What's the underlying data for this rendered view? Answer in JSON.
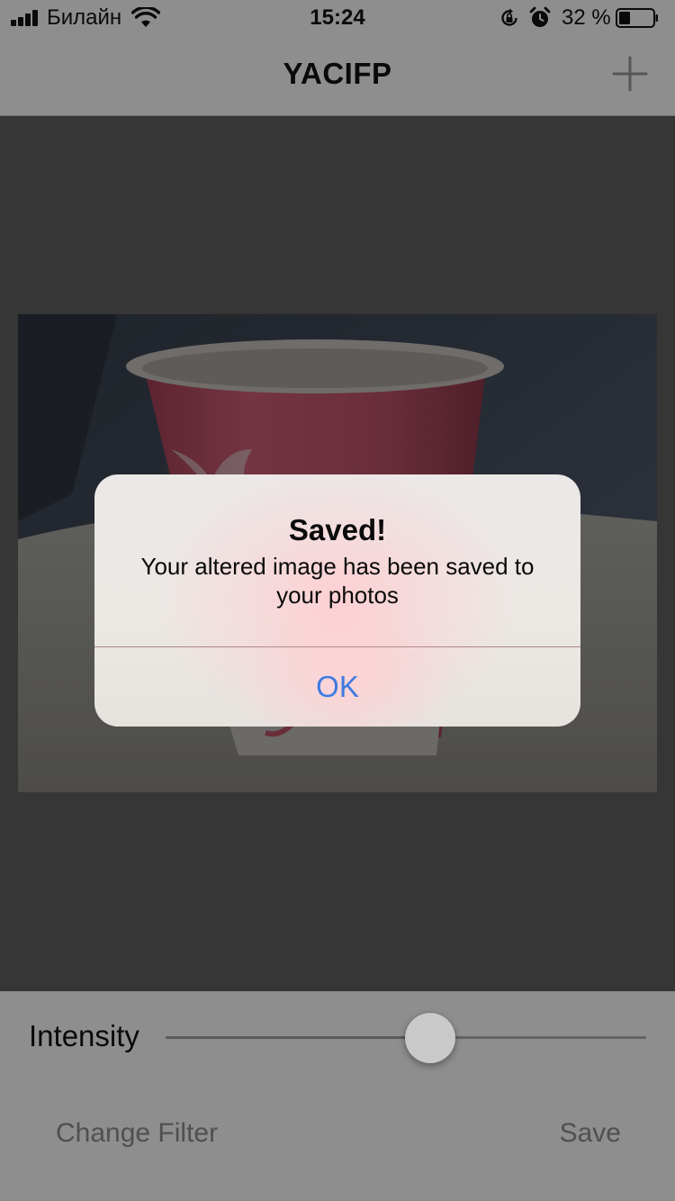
{
  "status_bar": {
    "carrier": "Билайн",
    "time": "15:24",
    "battery_percent": "32 %",
    "battery_level": 0.32,
    "icons": [
      "signal-icon",
      "wifi-icon",
      "orientation-lock-icon",
      "alarm-icon",
      "battery-icon"
    ]
  },
  "nav": {
    "title": "YACIFP",
    "add_icon": "plus-icon"
  },
  "photo": {
    "subject": "red-paper-cup-photo"
  },
  "controls": {
    "intensity_label": "Intensity",
    "intensity_value": 0.55,
    "change_filter_label": "Change Filter",
    "save_label": "Save"
  },
  "alert": {
    "title": "Saved!",
    "message": "Your altered image has been saved to your photos",
    "ok_label": "OK"
  },
  "colors": {
    "alert_button": "#3d7be0",
    "background_dimmed": "#363636",
    "bar_dimmed": "#8e8e8e"
  }
}
